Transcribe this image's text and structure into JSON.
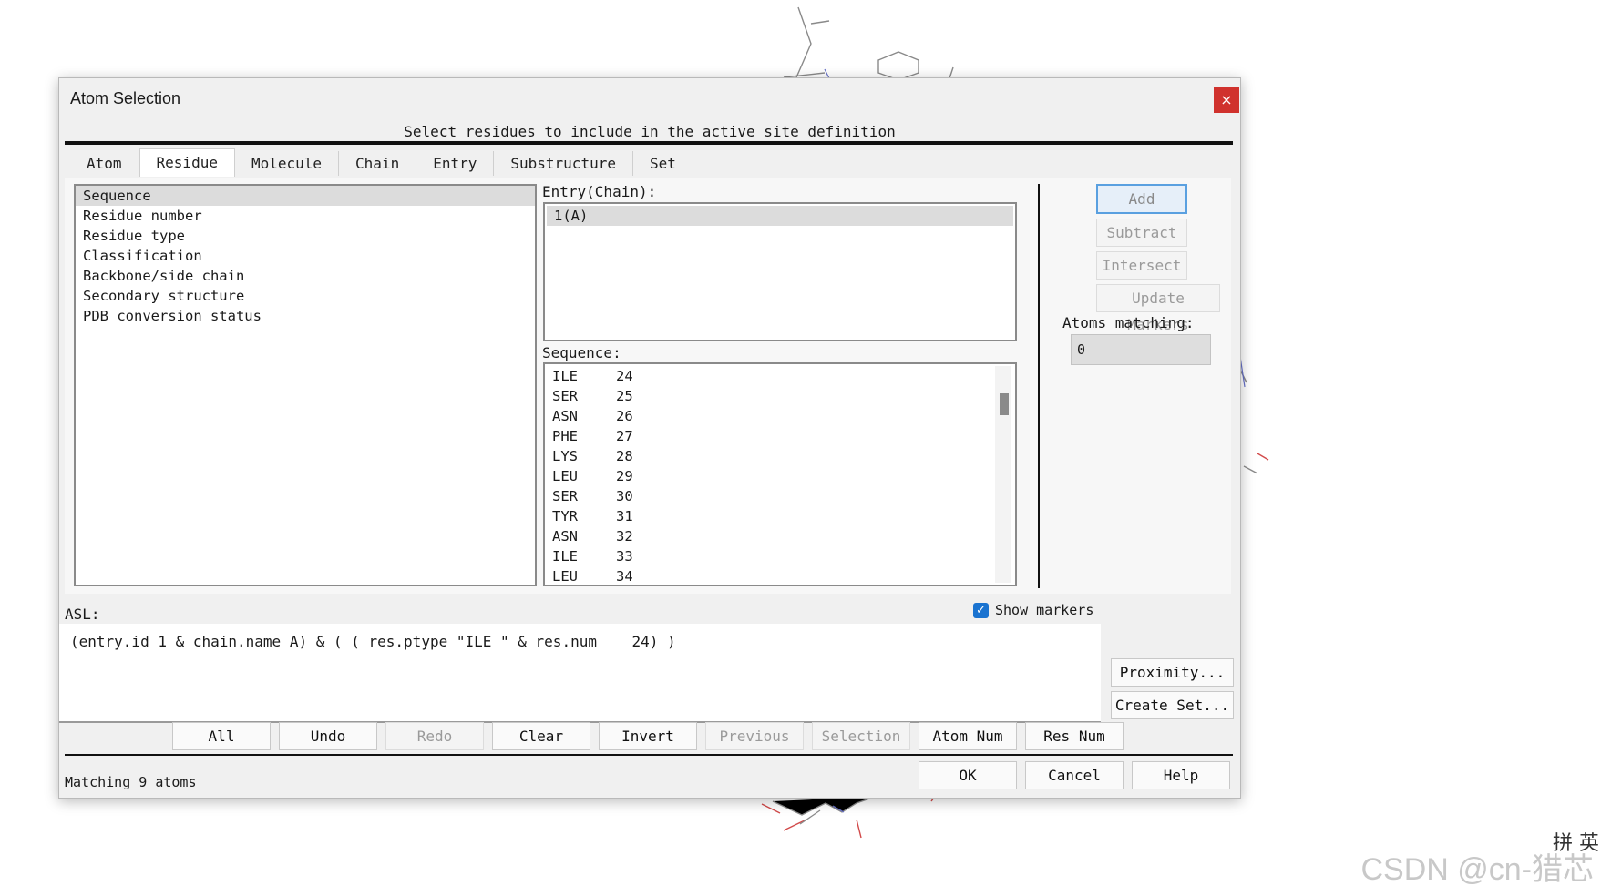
{
  "dialog": {
    "title": "Atom Selection",
    "close_glyph": "×",
    "instruction": "Select residues to include in the active site definition"
  },
  "tabs": [
    "Atom",
    "Residue",
    "Molecule",
    "Chain",
    "Entry",
    "Substructure",
    "Set"
  ],
  "active_tab": "Residue",
  "criteria": [
    "Sequence",
    "Residue number",
    "Residue type",
    "Classification",
    "Backbone/side chain",
    "Secondary structure",
    "PDB conversion status"
  ],
  "entry_chain": {
    "label": "Entry(Chain):",
    "items": [
      "1(A)"
    ]
  },
  "sequence": {
    "label": "Sequence:",
    "rows": [
      [
        "ILE",
        "24"
      ],
      [
        "SER",
        "25"
      ],
      [
        "ASN",
        "26"
      ],
      [
        "PHE",
        "27"
      ],
      [
        "LYS",
        "28"
      ],
      [
        "LEU",
        "29"
      ],
      [
        "SER",
        "30"
      ],
      [
        "TYR",
        "31"
      ],
      [
        "ASN",
        "32"
      ],
      [
        "ILE",
        "33"
      ],
      [
        "LEU",
        "34"
      ]
    ]
  },
  "actions": {
    "add": "Add",
    "subtract": "Subtract",
    "intersect": "Intersect",
    "update_markers": "Update Markers",
    "atoms_matching_label": "Atoms matching:",
    "atoms_matching_value": "0"
  },
  "asl": {
    "label": "ASL:",
    "expression": "(entry.id 1 & chain.name A) & ( ( res.ptype \"ILE \" & res.num    24) )",
    "show_markers_label": "Show markers",
    "show_markers_checked": true
  },
  "side_buttons": {
    "proximity": "Proximity...",
    "create_set": "Create Set..."
  },
  "toolbar": [
    "All",
    "Undo",
    "Redo",
    "Clear",
    "Invert",
    "Previous",
    "Selection",
    "Atom Num",
    "Res Num"
  ],
  "footer": {
    "status": "Matching 9 atoms",
    "ok": "OK",
    "cancel": "Cancel",
    "help": "Help"
  },
  "watermark": {
    "text": "CSDN @cn-猎芯",
    "icons": "拼 英"
  },
  "colors": {
    "close": "#d0322d",
    "checkbox": "#1a73d0",
    "primary_border": "#5aa0e0"
  }
}
